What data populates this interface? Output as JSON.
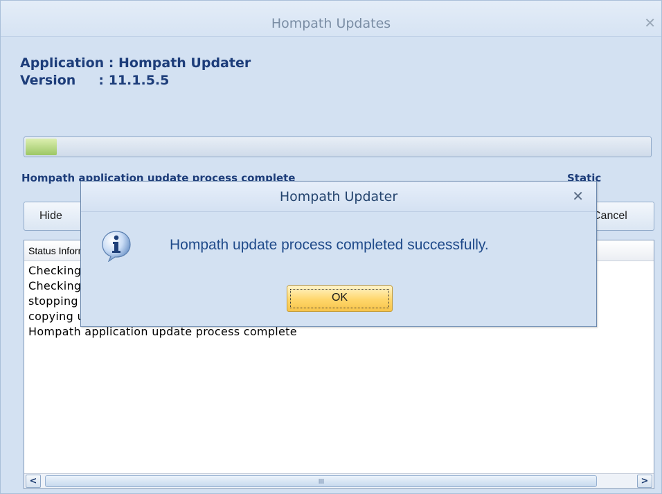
{
  "window": {
    "title": "Hompath Updates",
    "close": "✕"
  },
  "info": {
    "application": "Application : Hompath Updater",
    "version": "Version     : 11.1.5.5"
  },
  "progress": {
    "fraction": 0.05
  },
  "status": {
    "text": "Hompath application update process complete",
    "static_label": "Static"
  },
  "buttons": {
    "hide": "Hide",
    "cancel": "Cancel"
  },
  "log": {
    "header": "Status Information",
    "rows": [
      "Checking for updates",
      "Checking installed version",
      "stopping running services",
      "copying updated files",
      "Hompath application update process complete"
    ]
  },
  "scrollbar": {
    "left_arrow": "<",
    "right_arrow": ">",
    "grip": "IIII"
  },
  "dialog": {
    "title": "Hompath Updater",
    "close": "✕",
    "message": "Hompath update process completed successfully.",
    "ok": "OK"
  },
  "colors": {
    "window_bg": "#d3e1f2",
    "accent_text": "#1d3d7a",
    "ok_button": "#ffd66a"
  }
}
